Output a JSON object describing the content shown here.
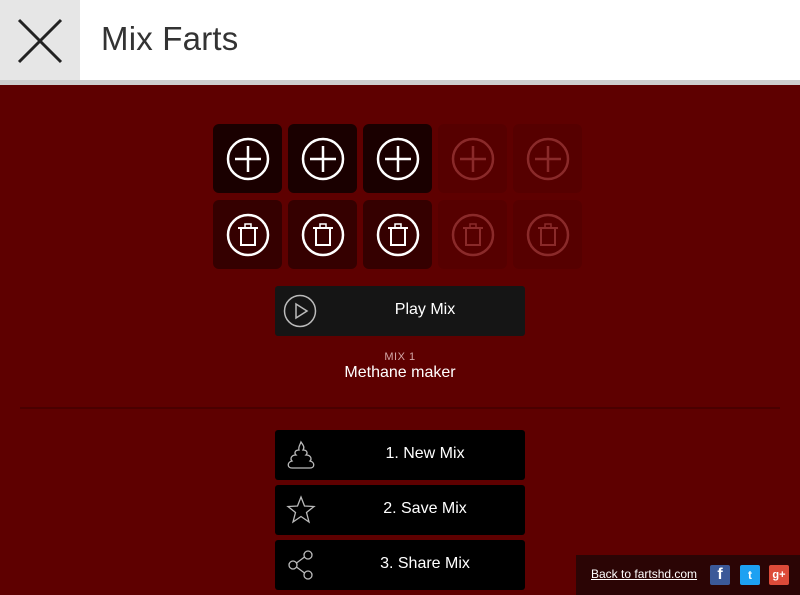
{
  "app": {
    "title": "Mix Farts"
  },
  "play": {
    "label": "Play Mix"
  },
  "mix": {
    "number_label": "MIX 1",
    "name": "Methane maker"
  },
  "actions": [
    {
      "label": "1.  New Mix",
      "icon": "poop-icon"
    },
    {
      "label": "2.  Save Mix",
      "icon": "star-icon"
    },
    {
      "label": "3.  Share Mix",
      "icon": "share-icon"
    }
  ],
  "slots": {
    "active_count": 3,
    "total": 5
  },
  "footer": {
    "back_link": "Back to fartshd.com",
    "social": {
      "facebook": "f",
      "twitter": "t",
      "google_plus": "g+"
    }
  },
  "colors": {
    "background": "#5e0000",
    "header": "#ffffff",
    "button": "#000000"
  }
}
